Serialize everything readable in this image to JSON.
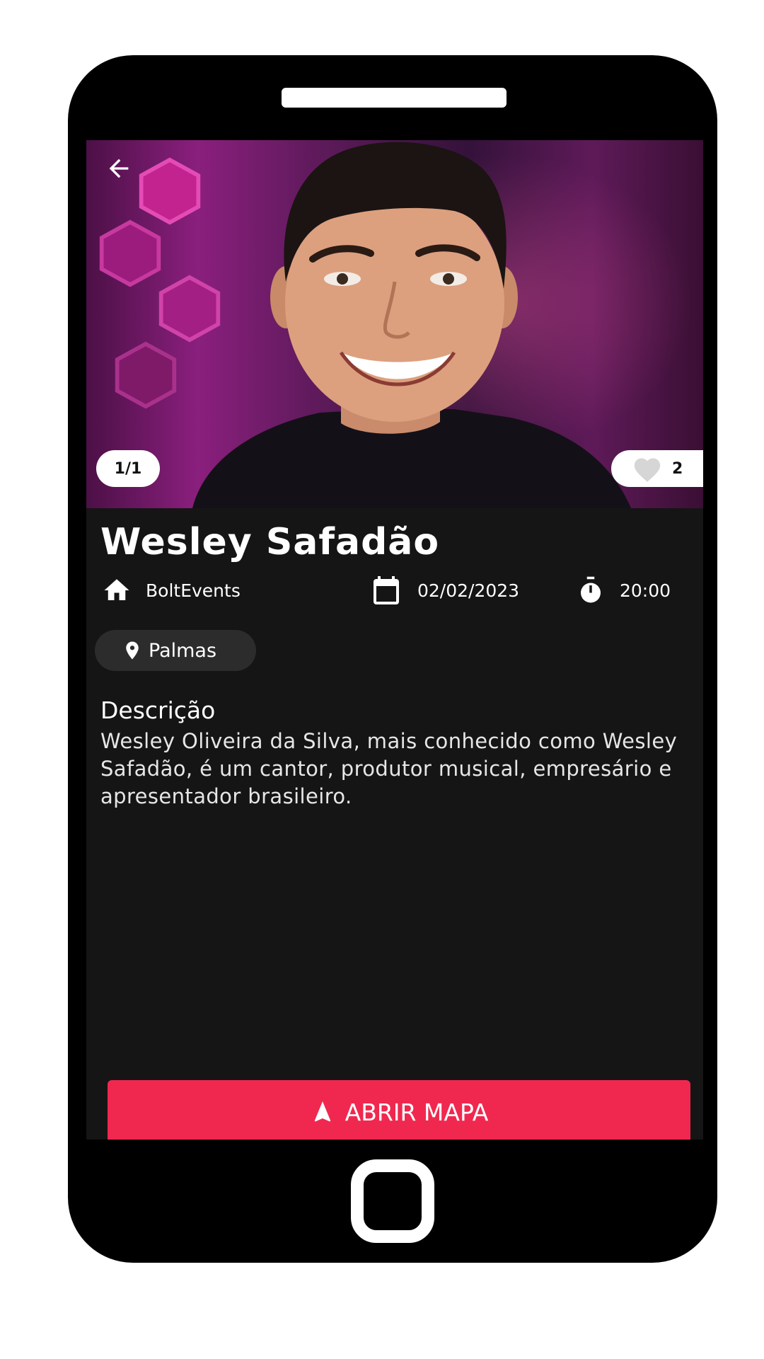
{
  "event": {
    "image_counter": "1/1",
    "likes": "2",
    "title": "Wesley Safadão",
    "organizer": "BoltEvents",
    "date": "02/02/2023",
    "time": "20:00",
    "city": "Palmas",
    "description_title": "Descrição",
    "description": "Wesley Oliveira da Silva, mais conhecido como Wesley Safadão, é um cantor, produtor musical, empresário e apresentador brasileiro."
  },
  "actions": {
    "open_map_label": "ABRIR MAPA"
  },
  "icons": {
    "back": "arrow-left-icon",
    "like": "heart-icon",
    "organizer": "home-icon",
    "date": "calendar-icon",
    "time": "timer-icon",
    "location": "location-pin-icon",
    "navigate": "navigation-arrow-icon"
  },
  "colors": {
    "background": "#151515",
    "accent": "#f0284f",
    "chip": "#2c2c2c",
    "text": "#ffffff"
  }
}
